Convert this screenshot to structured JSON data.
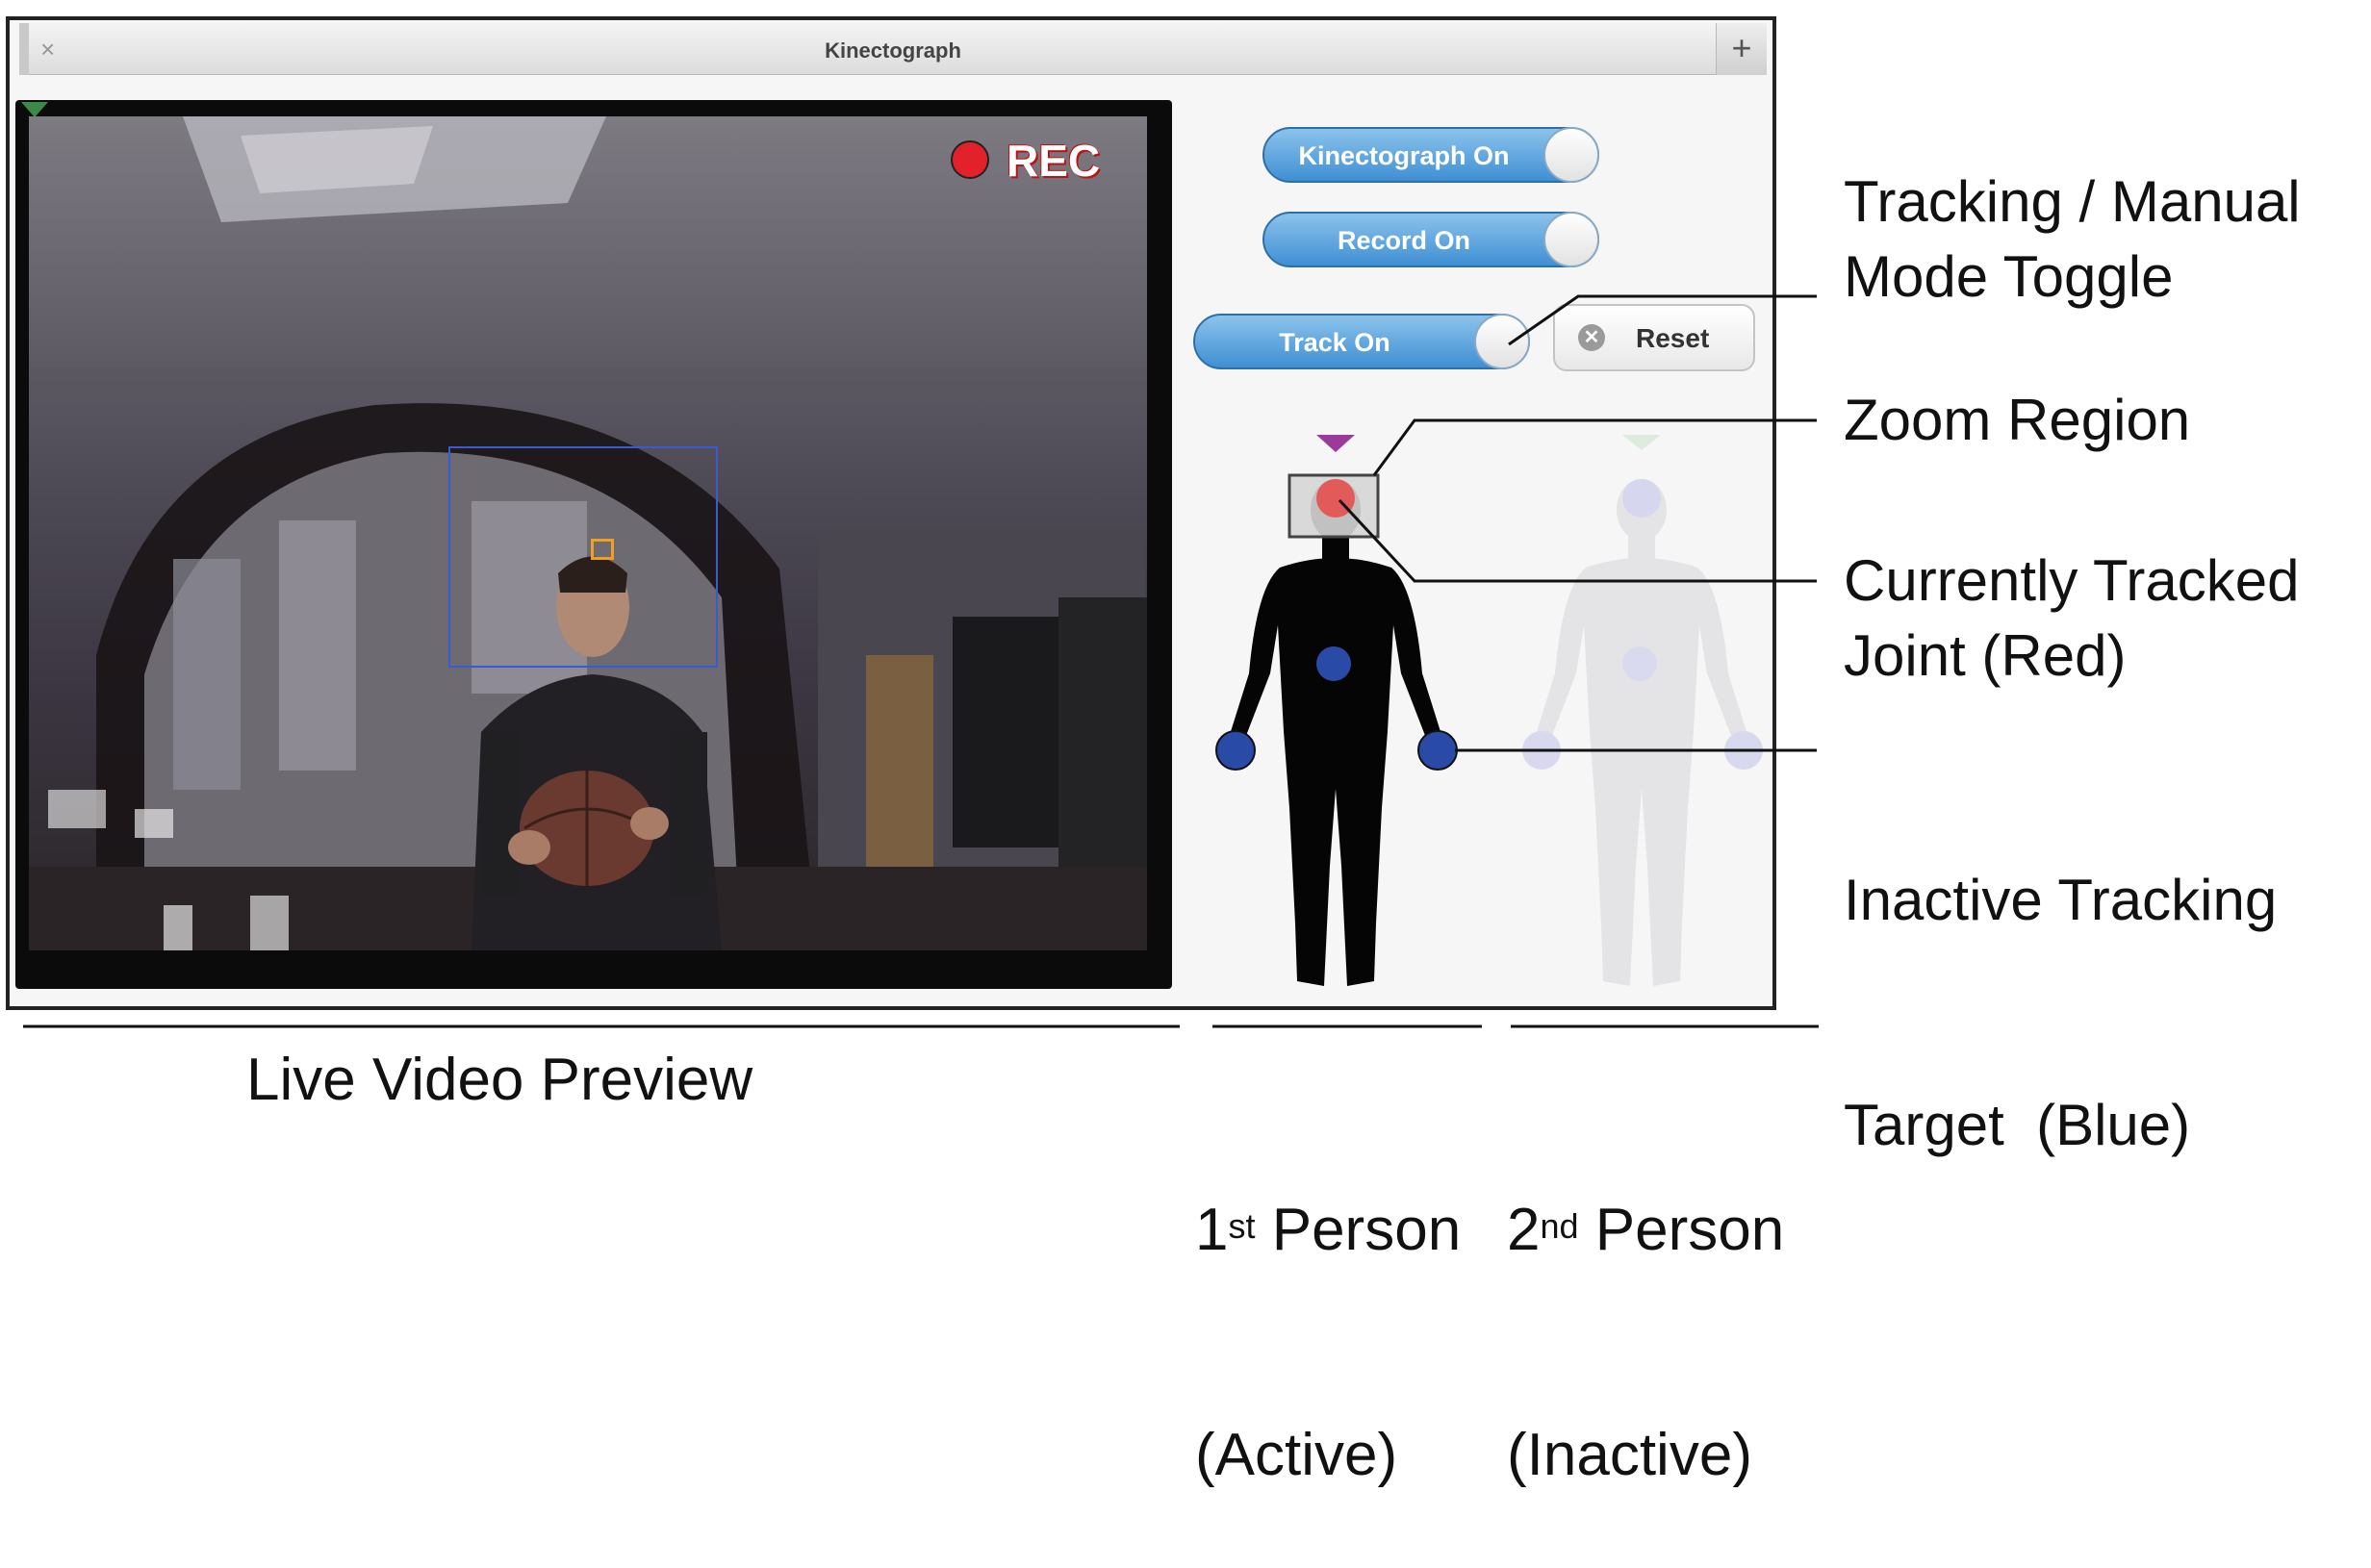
{
  "window": {
    "title": "Kinectograph",
    "close_glyph": "×",
    "add_glyph": "+"
  },
  "video": {
    "rec_label": "REC"
  },
  "controls": {
    "kinectograph_toggle": "Kinectograph On",
    "record_toggle": "Record On",
    "track_toggle": "Track On",
    "reset_button": "Reset",
    "reset_icon_glyph": "✕"
  },
  "annotations": {
    "mode_toggle_line1": "Tracking / Manual",
    "mode_toggle_line2": "Mode Toggle",
    "zoom_region": "Zoom Region",
    "tracked_joint_line1": "Currently Tracked",
    "tracked_joint_line2": "Joint (Red)",
    "inactive_target_line1": "Inactive Tracking",
    "inactive_target_line2": "Target  (Blue)"
  },
  "captions": {
    "live_video": "Live Video Preview",
    "first_person_num": "1",
    "first_person_sup": "st",
    "first_person_word": " Person",
    "first_person_state": "(Active)",
    "second_person_num": "2",
    "second_person_sup": "nd",
    "second_person_word": " Person",
    "second_person_state": "(Inactive)"
  },
  "colors": {
    "active_joint": "#e25a5a",
    "inactive_joint": "#2a4aa8",
    "toggle_blue": "#3f8fd3",
    "zoom_box": "#3a5ad0",
    "track_box": "#f0a020",
    "selector_purple": "#9a3a9a",
    "selector_green": "#3c8a4a",
    "rec_red": "#e3212a"
  }
}
